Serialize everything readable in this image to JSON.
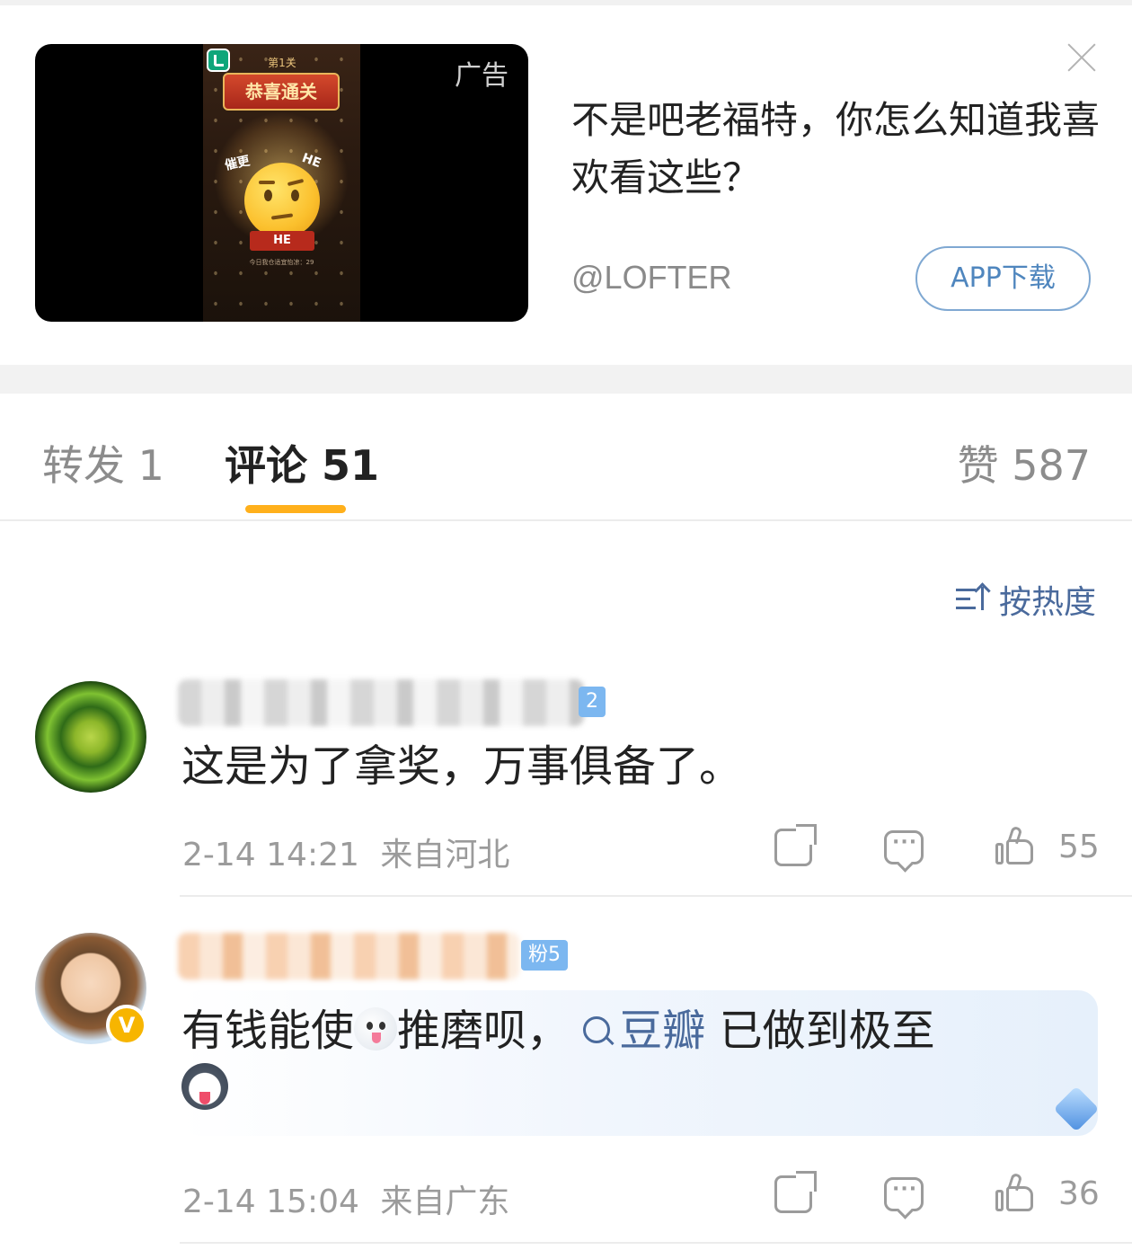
{
  "ad": {
    "label": "广告",
    "title": "不是吧老福特，你怎么知道我喜欢看这些？",
    "source": "@LOFTER",
    "cta": "APP下载",
    "shot": {
      "level": "第1关",
      "banner": "恭喜通关",
      "tag_left": "催更",
      "tag_right": "HE",
      "button": "HE",
      "subtext": "今日我仓适宜怡凉：29"
    }
  },
  "tabs": {
    "repost": "转发 1",
    "comments": "评论 51",
    "likes": "赞 587",
    "active": "comments",
    "indicator_color": "#ffb01c"
  },
  "sort": {
    "label": "按热度"
  },
  "comments": [
    {
      "fan_badge": "2",
      "text": "这是为了拿奖，万事俱备了。",
      "time": "2-14 14:21",
      "location": "来自河北",
      "likes": "55"
    },
    {
      "fan_badge": "粉5",
      "verified_badge": "V",
      "text_before": "有钱能使",
      "text_middle": "推磨呗，",
      "topic": "豆瓣",
      "text_after": " 已做到极至",
      "time": "2-14 15:04",
      "location": "来自广东",
      "likes": "36"
    }
  ],
  "colors": {
    "link": "#4a6a9c",
    "accent": "#ffb01c",
    "muted": "#9b9b9b"
  }
}
